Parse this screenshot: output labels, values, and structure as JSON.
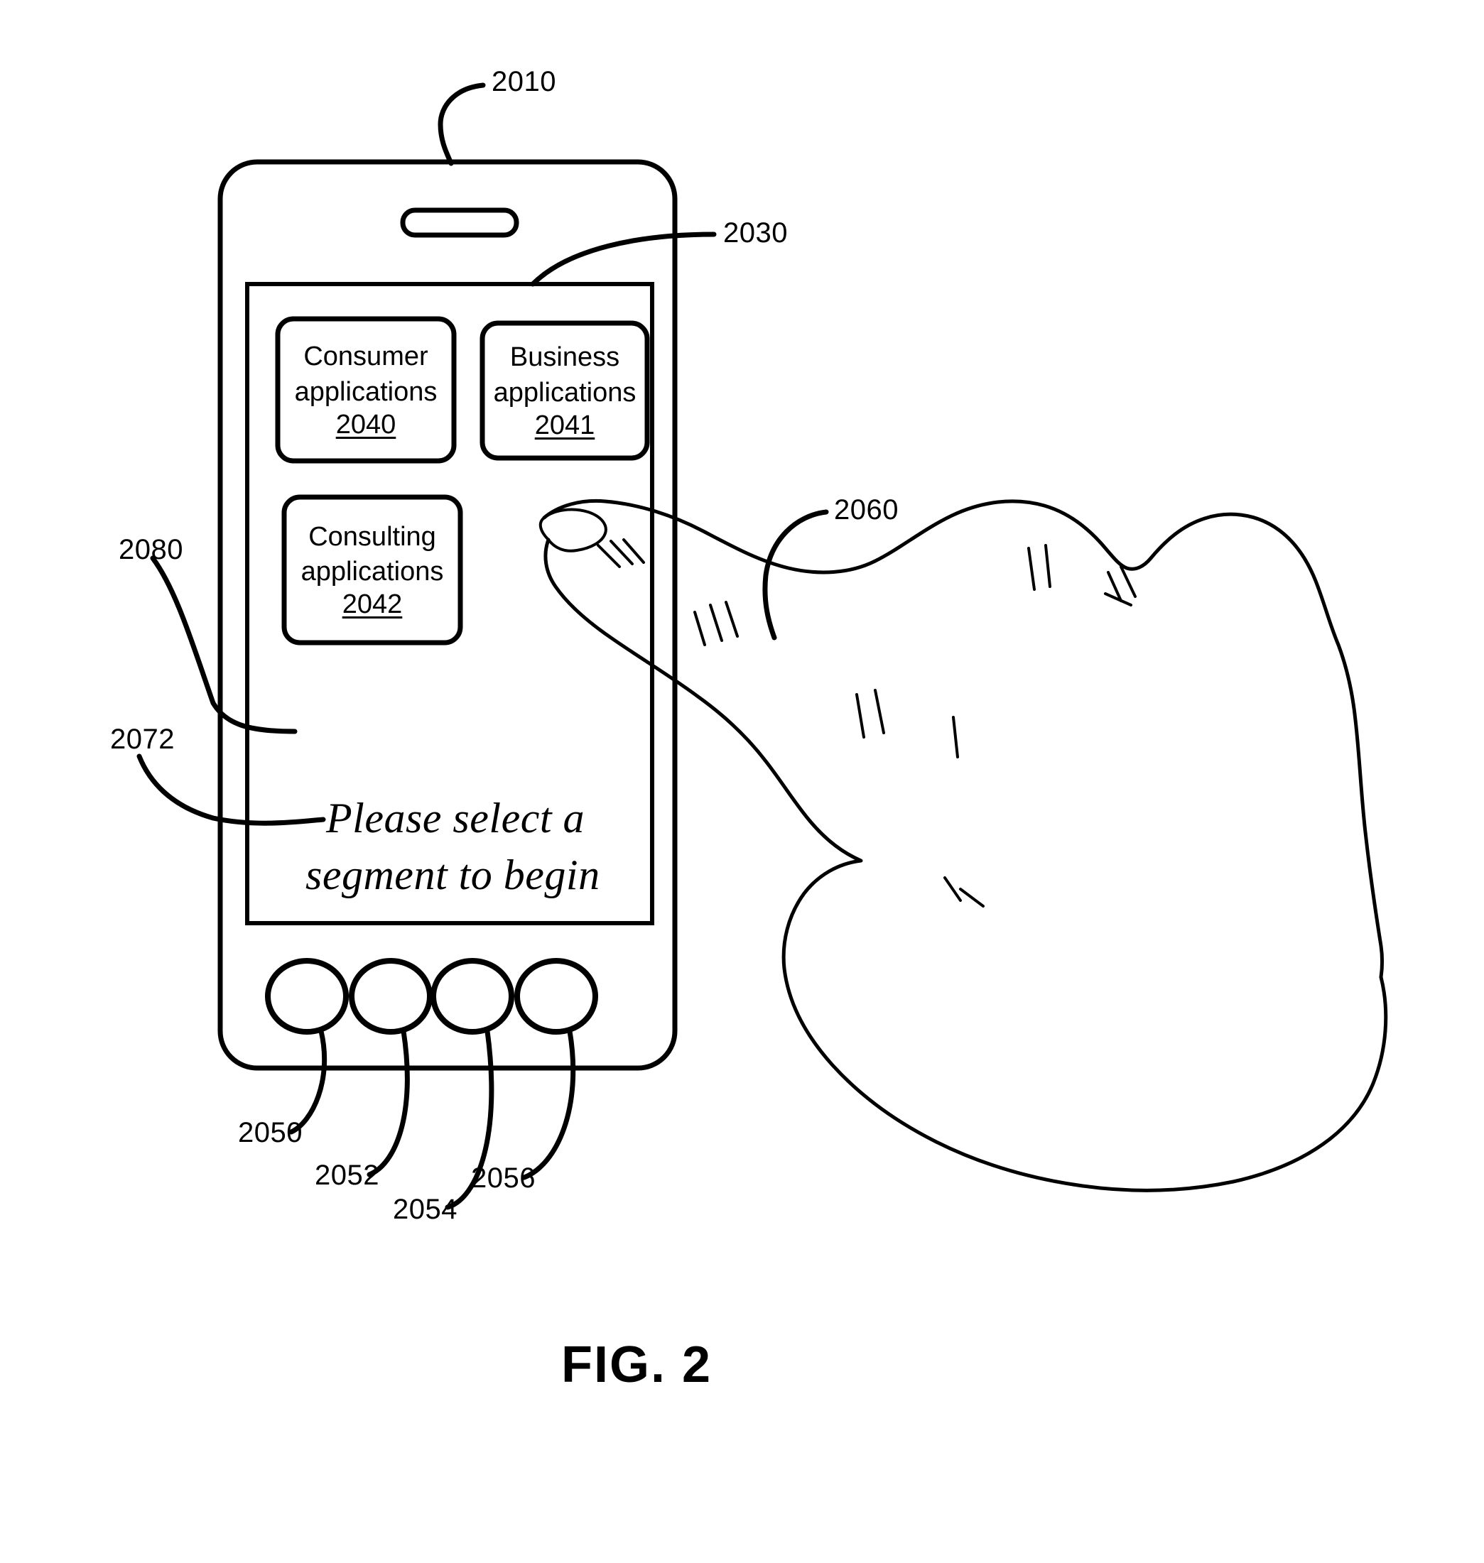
{
  "figure": {
    "caption": "FIG. 2",
    "background_color": "#ffffff",
    "line_color": "#000000"
  },
  "device": {
    "reference_number": "2010",
    "speaker_slot_name": "earpiece-speaker",
    "display": {
      "reference_number": "2030",
      "prompt": {
        "reference_number": "2072",
        "line1": "Please select a",
        "line2": "segment to begin"
      },
      "blank_area_reference_number": "2080",
      "tiles": [
        {
          "line1": "Consumer",
          "line2": "applications",
          "reference_number": "2040"
        },
        {
          "line1": "Business",
          "line2": "applications",
          "reference_number": "2041"
        },
        {
          "line1": "Consulting",
          "line2": "applications",
          "reference_number": "2042"
        }
      ]
    },
    "hardware_buttons": [
      {
        "reference_number": "2050"
      },
      {
        "reference_number": "2052"
      },
      {
        "reference_number": "2054"
      },
      {
        "reference_number": "2056"
      }
    ]
  },
  "hand": {
    "reference_number": "2060",
    "description": "finger-touching-screen"
  }
}
